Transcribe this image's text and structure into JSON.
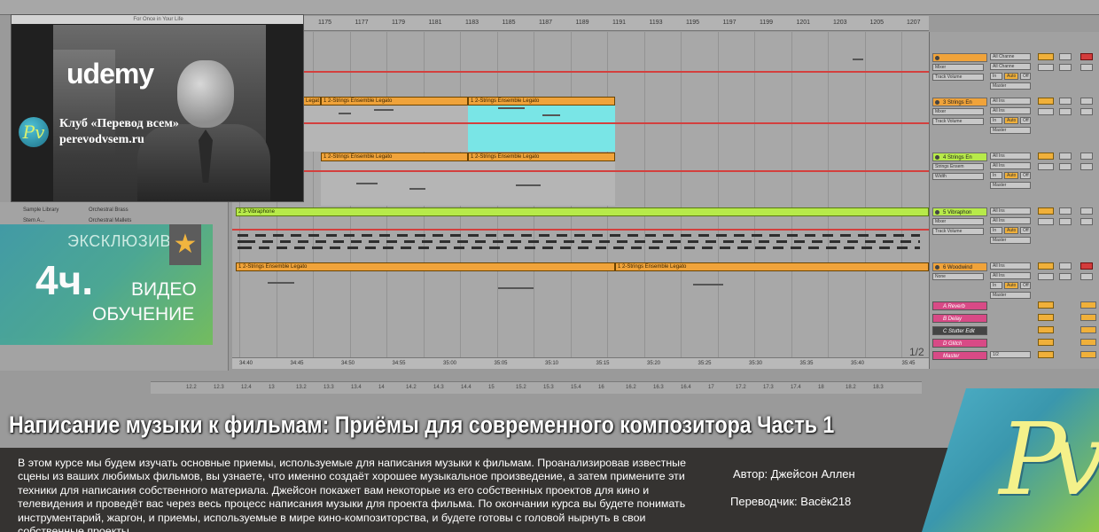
{
  "video": {
    "title": "For Once in Your Life",
    "brand": "udemy",
    "club_name": "Клуб «Перевод всем»",
    "club_url": "perevodvsem.ru",
    "club_logo_letter": "Pv"
  },
  "badge": {
    "exclusive": "ЭКСКЛЮЗИВ",
    "hours": "4ч.",
    "line1": "ВИДЕО",
    "line2": "ОБУЧЕНИЕ"
  },
  "daw": {
    "bar_numbers": [
      "1175",
      "1177",
      "1179",
      "1181",
      "1183",
      "1185",
      "1187",
      "1189",
      "1191",
      "1193",
      "1195",
      "1197",
      "1199",
      "1201",
      "1203",
      "1205",
      "1207"
    ],
    "time_marks": [
      "34:40",
      "34:45",
      "34:50",
      "34:55",
      "35:00",
      "35:05",
      "35:10",
      "35:15",
      "35:20",
      "35:25",
      "35:30",
      "35:35",
      "35:40",
      "35:45"
    ],
    "lower_ruler": [
      "12.2",
      "12.3",
      "12.4",
      "13",
      "13.2",
      "13.3",
      "13.4",
      "14",
      "14.2",
      "14.3",
      "14.4",
      "15",
      "15.2",
      "15.3",
      "15.4",
      "16",
      "16.2",
      "16.3",
      "16.4",
      "17",
      "17.2",
      "17.3",
      "17.4",
      "18",
      "18.2",
      "18.3"
    ],
    "page_counter": "1/2",
    "clips": {
      "strings_legato_a": "1 2-Strings Ensemble Legato",
      "strings_legato_prefix": "Legat",
      "vibraphone": "2 3-Vibraphone"
    },
    "browser_items": [
      "Sample Library",
      "Orchestral Brass",
      "Stem A...",
      "Orchestral Mallets"
    ],
    "mixer": {
      "tracks": [
        {
          "name": "",
          "color": "#f0a33a",
          "device": "Mixer",
          "param": "Track Volume",
          "route": "Master",
          "input": "All Channe"
        },
        {
          "name": "3 Strings En",
          "color": "#f0a33a",
          "device": "Mixer",
          "param": "Track Volume",
          "route": "Master",
          "input": "All Ins"
        },
        {
          "name": "4 Strings En",
          "color": "#b7ea4a",
          "device": "Strings Ensem",
          "param": "Width",
          "route": "Master",
          "input": "All Ins"
        },
        {
          "name": "5 Vibraphon",
          "color": "#b7ea4a",
          "device": "Mixer",
          "param": "Track Volume",
          "route": "Master",
          "input": "All Ins"
        },
        {
          "name": "6 Woodwind",
          "color": "#f0a33a",
          "device": "None",
          "param": "",
          "route": "Master",
          "input": "All Ins"
        }
      ],
      "returns": [
        {
          "name": "A Reverb",
          "color": "#d84a86"
        },
        {
          "name": "B Delay",
          "color": "#d84a86"
        },
        {
          "name": "C Stutter Edit",
          "color": "#444444"
        },
        {
          "name": "D Glitch",
          "color": "#d84a86"
        },
        {
          "name": "Master",
          "color": "#d84a86"
        }
      ],
      "io_labels": {
        "in": "In",
        "auto": "Auto",
        "off": "Off"
      },
      "master_ratio": "1/2"
    }
  },
  "course": {
    "title": "Написание музыки к фильмам: Приёмы для современного композитора Часть 1",
    "description": "В этом курсе мы будем изучать основные приемы, используемые для написания музыки к фильмам. Проанализировав известные сцены из ваших любимых фильмов, вы узнаете, что именно создаёт хорошее музыкальное произведение, а затем примените эти техники для написания собственного материала. Джейсон покажет вам некоторые из его собственных проектов для кино и телевидения и проведёт вас через весь процесс написания музыки для проекта фильма. По окончании курса вы будете понимать инструментарий, жаргон, и приемы, используемые в мире кино-композиторства, и будете готовы с головой нырнуть в свои собственные проекты.",
    "author": "Автор: Джейсон Аллен",
    "translator": "Переводчик: Васёк218"
  },
  "logo": {
    "letters": "Pv"
  },
  "colors": {
    "clip_orange": "#f0a33a",
    "clip_lime": "#b7ea4a",
    "selection_cyan": "#79e5e6",
    "automation_red": "#d3403e",
    "badge_start": "#3f9aa6",
    "badge_end": "#72bd5c",
    "star": "#f5b63b"
  }
}
